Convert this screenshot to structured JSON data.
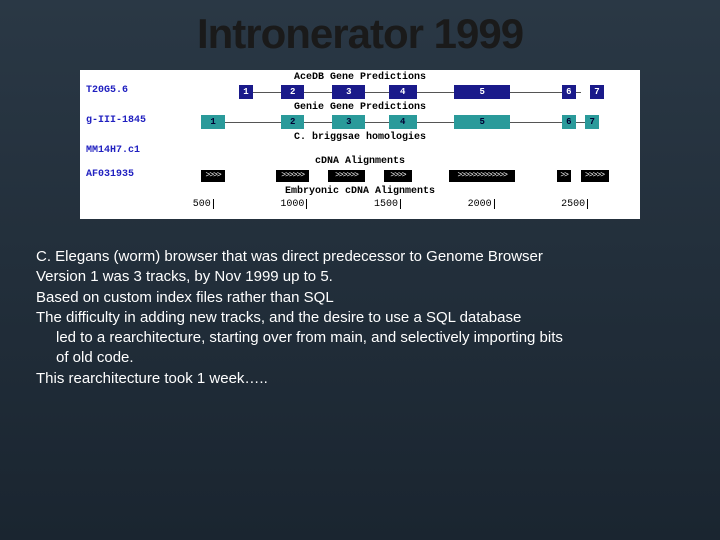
{
  "title": "Intronerator 1999",
  "browser": {
    "track1_title": "AceDB Gene Predictions",
    "track1_label": "T20G5.6",
    "track1_exons": [
      "1",
      "2",
      "3",
      "4",
      "5",
      "6",
      "7"
    ],
    "track2_title": "Genie Gene Predictions",
    "track2_label": "g-III-1845",
    "track2_exons": [
      "1",
      "2",
      "3",
      "4",
      "5",
      "6",
      "7"
    ],
    "track3_title": "C. briggsae homologies",
    "track3_label": "MM14H7.c1",
    "track4_title": "cDNA Alignments",
    "track4_label": "AF031935",
    "track5_title": "Embryonic cDNA Alignments",
    "ruler": [
      "500",
      "1000",
      "1500",
      "2000",
      "2500"
    ]
  },
  "body": {
    "l1": "C. Elegans (worm) browser that was direct predecessor to Genome Browser",
    "l2": "Version 1 was 3 tracks,  by Nov 1999 up to 5.",
    "l3": "Based on custom index files rather than SQL",
    "l4": "The difficulty in adding new tracks, and the desire to use a SQL database",
    "l5": "led to a rearchitecture, starting over from main, and selectively importing bits",
    "l6": "of old code.",
    "l7": "This rearchitecture took 1 week….."
  }
}
